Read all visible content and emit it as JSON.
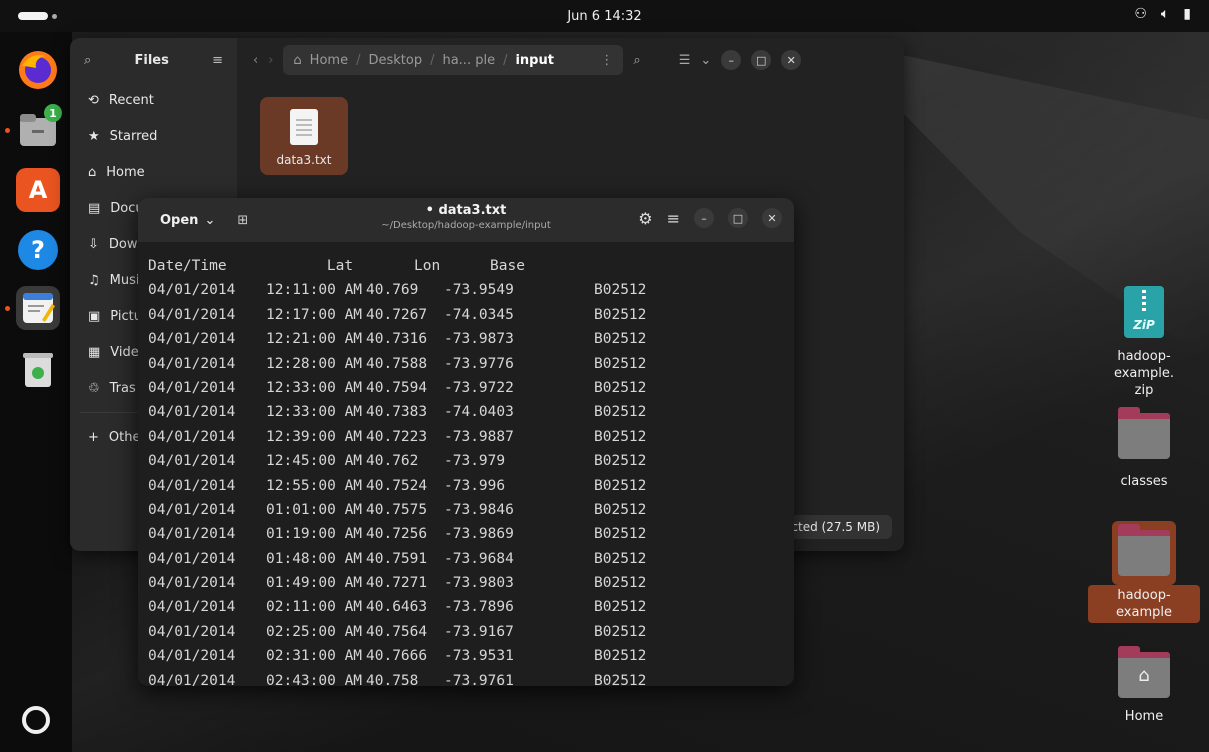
{
  "topbar": {
    "clock": "Jun 6  14:32",
    "tray": [
      "network-icon",
      "volume-icon",
      "battery-icon"
    ]
  },
  "dock": {
    "items": [
      {
        "name": "firefox",
        "icon": "firefox-icon",
        "color": "#ff7a18"
      },
      {
        "name": "files",
        "icon": "files-icon",
        "badge": "1",
        "color": "#9a9a9a"
      },
      {
        "name": "app-center",
        "icon": "app-center-icon",
        "glyph": "A",
        "color": "#e95420"
      },
      {
        "name": "help",
        "icon": "help-icon",
        "glyph": "?",
        "color": "#1e88e5"
      },
      {
        "name": "text-editor",
        "icon": "text-editor-icon",
        "color": "#3d7fd8"
      },
      {
        "name": "trash",
        "icon": "trash-icon",
        "color": "#d9d9d9"
      }
    ]
  },
  "files": {
    "title": "Files",
    "sidebar": [
      {
        "label": "Recent",
        "icon": "clock-icon",
        "glyph": "⟲"
      },
      {
        "label": "Starred",
        "icon": "star-icon",
        "glyph": "★"
      },
      {
        "label": "Home",
        "icon": "home-icon",
        "glyph": "⌂"
      },
      {
        "label": "Docu",
        "icon": "document-icon",
        "glyph": "▤"
      },
      {
        "label": "Dow",
        "icon": "download-icon",
        "glyph": "⇩"
      },
      {
        "label": "Musi",
        "icon": "music-icon",
        "glyph": "♫"
      },
      {
        "label": "Pictu",
        "icon": "picture-icon",
        "glyph": "▣"
      },
      {
        "label": "Vide",
        "icon": "video-icon",
        "glyph": "▦"
      },
      {
        "label": "Tras",
        "icon": "trash-icon",
        "glyph": "♲"
      },
      {
        "label": "Othe",
        "icon": "plus-icon",
        "glyph": "+"
      }
    ],
    "path": [
      "Home",
      "Desktop",
      "ha... ple",
      "input"
    ],
    "file": {
      "name": "data3.txt"
    },
    "status": "ected (27.5 MB)"
  },
  "editor": {
    "open_label": "Open",
    "title": "• data3.txt",
    "subtitle": "~/Desktop/hadoop-example/input",
    "header": {
      "date": "Date/Time",
      "lat": "Lat",
      "lon": "Lon",
      "base": "Base"
    },
    "rows": [
      {
        "date": "04/01/2014",
        "time": "12:11:00 AM",
        "lat": "40.769",
        "lon": "-73.9549",
        "base": "B02512"
      },
      {
        "date": "04/01/2014",
        "time": "12:17:00 AM",
        "lat": "40.7267",
        "lon": "-74.0345",
        "base": "B02512"
      },
      {
        "date": "04/01/2014",
        "time": "12:21:00 AM",
        "lat": "40.7316",
        "lon": "-73.9873",
        "base": "B02512"
      },
      {
        "date": "04/01/2014",
        "time": "12:28:00 AM",
        "lat": "40.7588",
        "lon": "-73.9776",
        "base": "B02512"
      },
      {
        "date": "04/01/2014",
        "time": "12:33:00 AM",
        "lat": "40.7594",
        "lon": "-73.9722",
        "base": "B02512"
      },
      {
        "date": "04/01/2014",
        "time": "12:33:00 AM",
        "lat": "40.7383",
        "lon": "-74.0403",
        "base": "B02512"
      },
      {
        "date": "04/01/2014",
        "time": "12:39:00 AM",
        "lat": "40.7223",
        "lon": "-73.9887",
        "base": "B02512"
      },
      {
        "date": "04/01/2014",
        "time": "12:45:00 AM",
        "lat": "40.762",
        "lon": "-73.979",
        "base": "B02512"
      },
      {
        "date": "04/01/2014",
        "time": "12:55:00 AM",
        "lat": "40.7524",
        "lon": "-73.996",
        "base": "B02512"
      },
      {
        "date": "04/01/2014",
        "time": "01:01:00 AM",
        "lat": "40.7575",
        "lon": "-73.9846",
        "base": "B02512"
      },
      {
        "date": "04/01/2014",
        "time": "01:19:00 AM",
        "lat": "40.7256",
        "lon": "-73.9869",
        "base": "B02512"
      },
      {
        "date": "04/01/2014",
        "time": "01:48:00 AM",
        "lat": "40.7591",
        "lon": "-73.9684",
        "base": "B02512"
      },
      {
        "date": "04/01/2014",
        "time": "01:49:00 AM",
        "lat": "40.7271",
        "lon": "-73.9803",
        "base": "B02512"
      },
      {
        "date": "04/01/2014",
        "time": "02:11:00 AM",
        "lat": "40.6463",
        "lon": "-73.7896",
        "base": "B02512"
      },
      {
        "date": "04/01/2014",
        "time": "02:25:00 AM",
        "lat": "40.7564",
        "lon": "-73.9167",
        "base": "B02512"
      },
      {
        "date": "04/01/2014",
        "time": "02:31:00 AM",
        "lat": "40.7666",
        "lon": "-73.9531",
        "base": "B02512"
      },
      {
        "date": "04/01/2014",
        "time": "02:43:00 AM",
        "lat": "40.758",
        "lon": "-73.9761",
        "base": "B02512"
      }
    ]
  },
  "desktop": {
    "icons": [
      {
        "label": "hadoop-example.\nzip",
        "type": "zip",
        "glyph": "ZiP"
      },
      {
        "label": "classes",
        "type": "folder"
      },
      {
        "label": "hadoop-example",
        "type": "folder",
        "selected": true
      },
      {
        "label": "Home",
        "type": "home-folder"
      }
    ]
  },
  "colors": {
    "accent": "#e95420",
    "selection": "#6b3a26",
    "window": "#222222"
  }
}
